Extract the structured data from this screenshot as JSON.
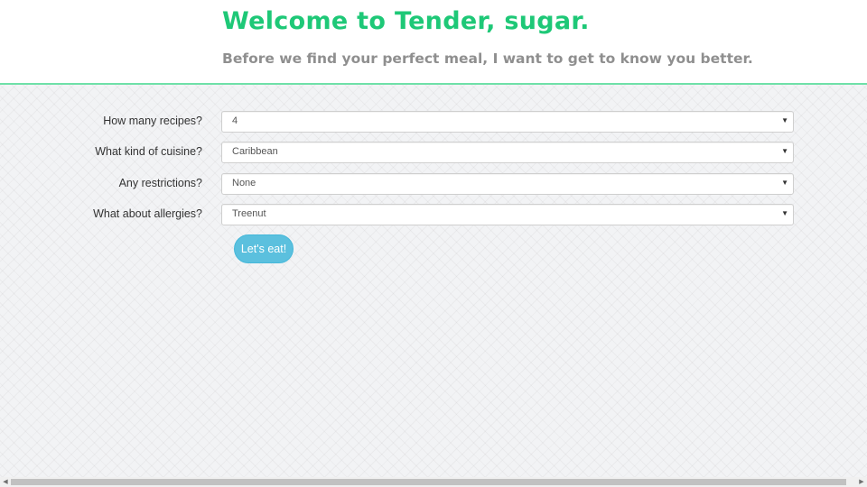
{
  "header": {
    "title": "Welcome to Tender, sugar.",
    "subtitle": "Before we find your perfect meal, I want to get to know you better."
  },
  "form": {
    "fields": [
      {
        "label": "How many recipes?",
        "value": "4"
      },
      {
        "label": "What kind of cuisine?",
        "value": "Caribbean"
      },
      {
        "label": "Any restrictions?",
        "value": "None"
      },
      {
        "label": "What about allergies?",
        "value": "Treenut"
      }
    ],
    "submit_label": "Let's eat!"
  },
  "icons": {
    "select_caret": "▼",
    "scroll_left": "◀",
    "scroll_right": "▶"
  },
  "colors": {
    "title": "#1ec877",
    "subtitle": "#8f8f8f",
    "header_border": "#6fe0a8",
    "button": "#5bc0de"
  }
}
